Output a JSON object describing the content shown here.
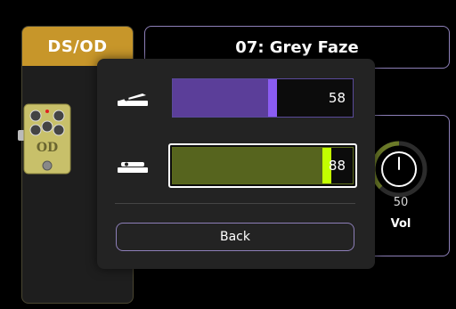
{
  "block": {
    "label": "DS/OD",
    "pedal_name": "OD"
  },
  "preset": {
    "title": "07: Grey Faze"
  },
  "knob": {
    "value": "50",
    "label": "Vol",
    "level_fraction": 0.5
  },
  "modal": {
    "sliders": [
      {
        "icon": "expression-pedal-heel-icon",
        "value": "58",
        "fill_fraction": 0.58,
        "color": "#5b3e99",
        "thumb_color": "#8b5cf2"
      },
      {
        "icon": "expression-pedal-toe-icon",
        "value": "88",
        "fill_fraction": 0.88,
        "color": "#56641e",
        "thumb_color": "#c3ff00"
      }
    ],
    "back_label": "Back"
  },
  "colors": {
    "accent": "#c7962a",
    "border": "#8d7fb8"
  }
}
